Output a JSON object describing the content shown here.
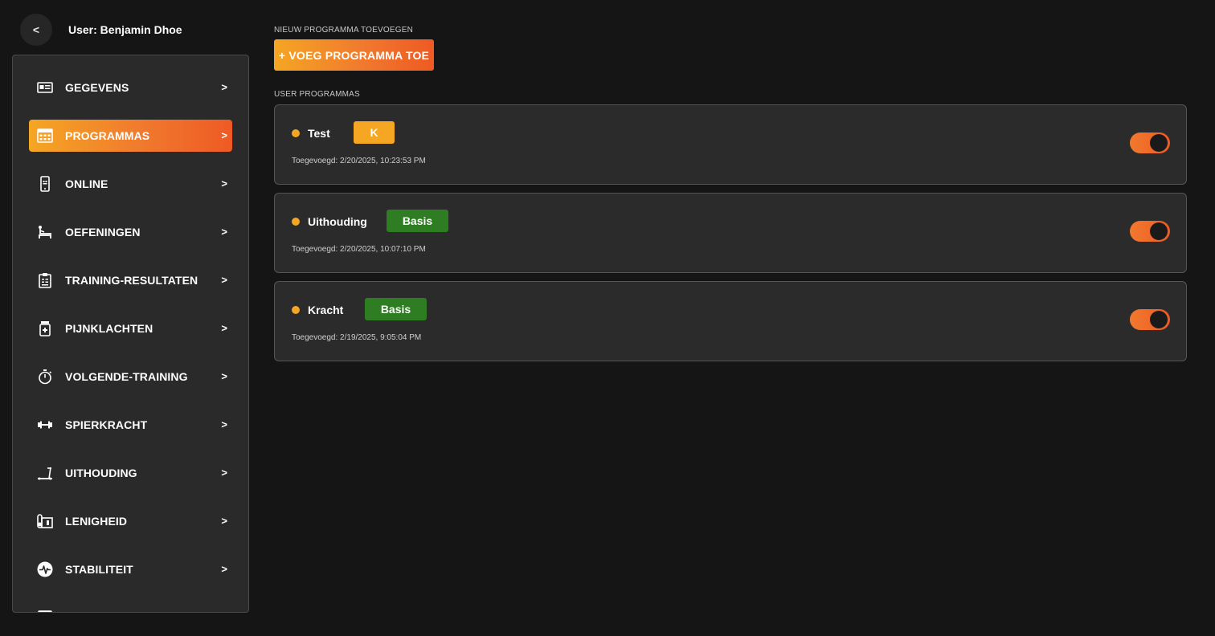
{
  "header": {
    "back_label": "<",
    "user_label": "User: Benjamin Dhoe"
  },
  "sidebar": {
    "items": [
      {
        "label": "GEGEVENS",
        "icon": "id-card-icon",
        "chevron": ">",
        "active": false
      },
      {
        "label": "PROGRAMMAS",
        "icon": "calendar-grid-icon",
        "chevron": ">",
        "active": true
      },
      {
        "label": "ONLINE",
        "icon": "smartphone-icon",
        "chevron": ">",
        "active": false
      },
      {
        "label": "OEFENINGEN",
        "icon": "exercise-bench-icon",
        "chevron": ">",
        "active": false
      },
      {
        "label": "TRAINING-RESULTATEN",
        "icon": "clipboard-icon",
        "chevron": ">",
        "active": false
      },
      {
        "label": "PIJNKLACHTEN",
        "icon": "medicine-jar-icon",
        "chevron": ">",
        "active": false
      },
      {
        "label": "VOLGENDE-TRAINING",
        "icon": "stopwatch-icon",
        "chevron": ">",
        "active": false
      },
      {
        "label": "SPIERKRACHT",
        "icon": "dumbbell-icon",
        "chevron": ">",
        "active": false
      },
      {
        "label": "UITHOUDING",
        "icon": "treadmill-icon",
        "chevron": ">",
        "active": false
      },
      {
        "label": "LENIGHEID",
        "icon": "yoga-mat-icon",
        "chevron": ">",
        "active": false
      },
      {
        "label": "STABILITEIT",
        "icon": "pulse-icon",
        "chevron": ">",
        "active": false
      }
    ]
  },
  "main": {
    "new_section_title": "NIEUW PROGRAMMA TOEVOEGEN",
    "add_button_label": "+ VOEG PROGRAMMA TOE",
    "list_section_title": "USER PROGRAMMAS",
    "programs": [
      {
        "name": "Test",
        "badge": "K",
        "badge_color": "#f5a623",
        "added": "Toegevoegd: 2/20/2025, 10:23:53 PM",
        "enabled": true
      },
      {
        "name": "Uithouding",
        "badge": "Basis",
        "badge_color": "#2e7d22",
        "added": "Toegevoegd: 2/20/2025, 10:07:10 PM",
        "enabled": true
      },
      {
        "name": "Kracht",
        "badge": "Basis",
        "badge_color": "#2e7d22",
        "added": "Toegevoegd: 2/19/2025, 9:05:04 PM",
        "enabled": true
      }
    ]
  },
  "colors": {
    "accent_start": "#f5a623",
    "accent_end": "#ee5a24",
    "badge_green": "#2e7d22",
    "background": "#151515",
    "panel": "#2a2a2a"
  }
}
